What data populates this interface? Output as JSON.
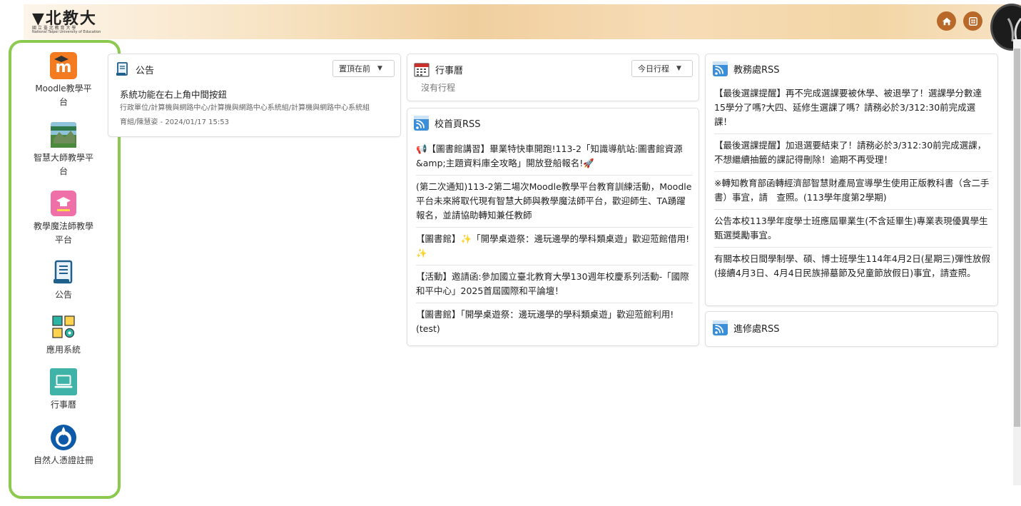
{
  "header": {
    "logo_title": "▼北教大",
    "logo_sub": "國 立 臺 北 教 育 大 學",
    "logo_en": "National Taipei University of Education",
    "home_icon": "home-icon",
    "calendar_icon": "grid-calendar-icon"
  },
  "sidebar": {
    "items": [
      {
        "label": "Moodle教學平台",
        "icon": "moodle-icon"
      },
      {
        "label": "智慧大師教學平台",
        "icon": "smart-master-icon"
      },
      {
        "label": "教學魔法師教學平台",
        "icon": "teaching-wizard-icon"
      },
      {
        "label": "公告",
        "icon": "announcement-scroll-icon"
      },
      {
        "label": "應用系統",
        "icon": "apps-grid-icon"
      },
      {
        "label": "行事曆",
        "icon": "laptop-icon"
      },
      {
        "label": "自然人憑證註冊",
        "icon": "citizen-cert-icon"
      }
    ]
  },
  "announcement": {
    "title": "公告",
    "dropdown": "置頂在前",
    "item_title": "系統功能在右上角中間按鈕",
    "item_path": "行政單位/計算機與網路中心/計算機與網路中心系統組/計算機與網路中心系統組",
    "item_author": "育組/陳慧姿 - 2024/01/17 15:53"
  },
  "calendar": {
    "title": "行事曆",
    "dropdown": "今日行程",
    "empty": "沒有行程"
  },
  "homepage_rss": {
    "title": "校首頁RSS",
    "items": [
      "📢【圖書館講習】畢業特快車開跑!113-2「知識導航站:圖書館資源&amp;主題資料庫全攻略」開放登船報名!🚀",
      "(第二次通知)113-2第二場次Moodle教學平台教育訓練活動，Moodle平台未來將取代現有智慧大師與教學魔法師平台，歡迎師生、TA踴躍報名，並請協助轉知兼任教師",
      "【圖書館】✨「開學桌遊祭：邊玩邊學的學科類桌遊」歡迎蒞館借用!✨",
      "【活動】邀請函:參加國立臺北教育大學130週年校慶系列活動-「國際和平中心」2025首屆國際和平論壇！",
      "【圖書館】「開學桌遊祭：邊玩邊學的學科類桌遊」歡迎蒞館利用!(test)"
    ]
  },
  "academic_rss": {
    "title": "教務處RSS",
    "items": [
      "【最後選課提醒】再不完成選課要被休學、被退學了！選課學分數達15學分了嗎?大四、延修生選課了嗎？請務必於3/312:30前完成選課！",
      "【最後選課提醒】加退選要結束了！請務必於3/312:30前完成選課，不想繼續抽籤的課記得刪除！逾期不再受理！",
      "※轉知教育部函轉經濟部智慧財產局宣導學生使用正版教科書（含二手書）事宜，請　查照。(113學年度第2學期)",
      "公告本校113學年度學士班應屆畢業生(不含延畢生)專業表現優異學生甄選獎勵事宜。",
      "有關本校日間學制學、碩、博士班學生114年4月2日(星期三)彈性放假(接續4月3日、4月4日民族掃墓節及兒童節放假日)事宜，請查照。"
    ]
  },
  "continuing_rss": {
    "title": "進修處RSS"
  },
  "colors": {
    "sidebar_highlight": "#8bc94f",
    "header_button": "#b8692a",
    "rss_blue": "#3b8fd9"
  }
}
